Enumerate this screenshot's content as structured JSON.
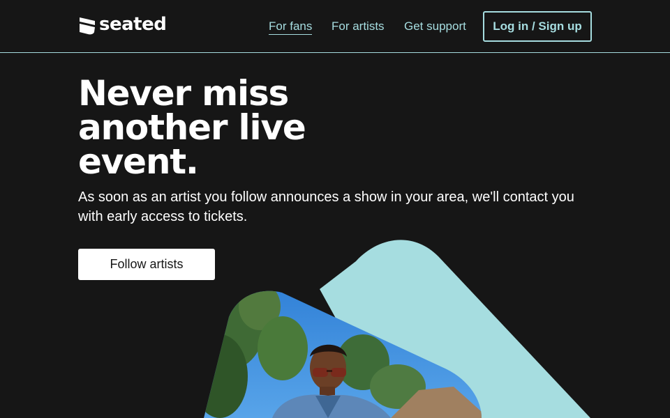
{
  "header": {
    "logo_text": "seated",
    "nav": [
      {
        "label": "For fans",
        "active": true
      },
      {
        "label": "For artists",
        "active": false
      },
      {
        "label": "Get support",
        "active": false
      }
    ],
    "login_label": "Log in / Sign up"
  },
  "hero": {
    "title_lines": [
      "Never miss",
      "another live",
      "event."
    ],
    "subtitle": "As soon as an artist you follow announces a show in your area, we'll contact you with early access to tickets.",
    "cta_label": "Follow artists"
  },
  "colors": {
    "background": "#161616",
    "accent": "#a6dde0",
    "text": "#ffffff"
  },
  "icons": [
    "seated-logo-icon"
  ]
}
